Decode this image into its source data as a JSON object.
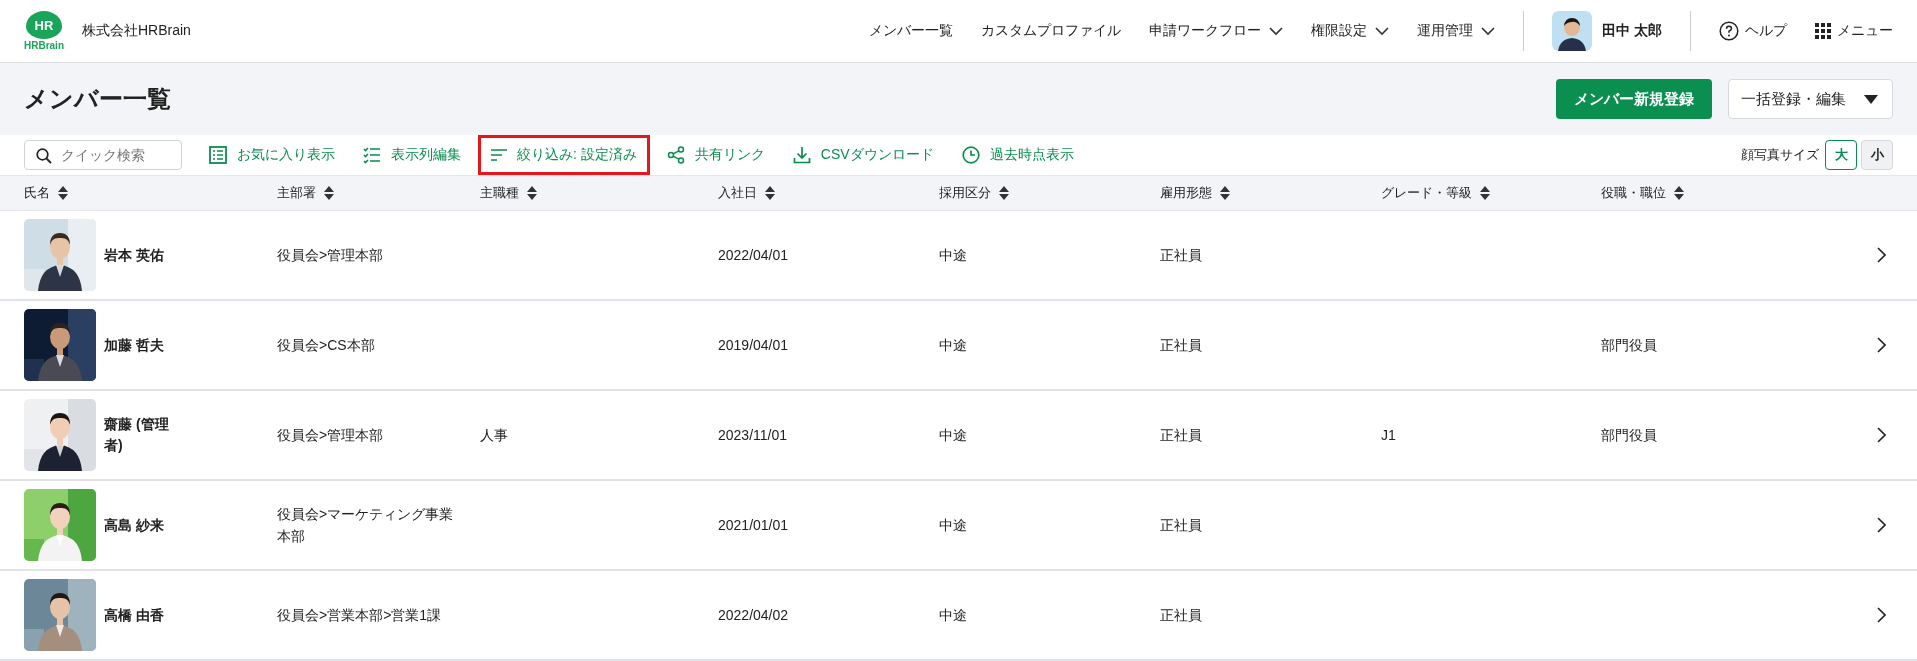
{
  "header": {
    "logo": {
      "mark": "HR",
      "wordmark": "HRBrain"
    },
    "company": "株式会社HRBrain",
    "nav": [
      {
        "label": "メンバー一覧",
        "dropdown": false
      },
      {
        "label": "カスタムプロファイル",
        "dropdown": false
      },
      {
        "label": "申請ワークフロー",
        "dropdown": true
      },
      {
        "label": "権限設定",
        "dropdown": true
      },
      {
        "label": "運用管理",
        "dropdown": true
      }
    ],
    "user": "田中 太郎",
    "help": "ヘルプ",
    "menu": "メニュー"
  },
  "page": {
    "title": "メンバー一覧",
    "primary_button": "メンバー新規登録",
    "bulk_button": "一括登録・編集"
  },
  "toolbar": {
    "search": {
      "placeholder": "クイック検索"
    },
    "actions": [
      {
        "label": "お気に入り表示",
        "highlighted": false
      },
      {
        "label": "表示列編集",
        "highlighted": false
      },
      {
        "label": "絞り込み: 設定済み",
        "highlighted": true
      },
      {
        "label": "共有リンク",
        "highlighted": false
      },
      {
        "label": "CSVダウンロード",
        "highlighted": false
      },
      {
        "label": "過去時点表示",
        "highlighted": false
      }
    ],
    "photo_size": {
      "label": "顔写真サイズ",
      "options": [
        {
          "label": "大",
          "selected": true
        },
        {
          "label": "小",
          "selected": false
        }
      ]
    }
  },
  "table": {
    "columns": [
      "氏名",
      "主部署",
      "主職種",
      "入社日",
      "採用区分",
      "雇用形態",
      "グレード・等級",
      "役職・職位"
    ],
    "rows": [
      {
        "cells": [
          "岩本 英佑",
          "役員会>管理本部",
          "",
          "2022/04/01",
          "中途",
          "正社員",
          "",
          ""
        ]
      },
      {
        "cells": [
          "加藤 哲夫",
          "役員会>CS本部",
          "",
          "2019/04/01",
          "中途",
          "正社員",
          "",
          "部門役員"
        ]
      },
      {
        "cells": [
          "齋藤 (管理者)",
          "役員会>管理本部",
          "人事",
          "2023/11/01",
          "中途",
          "正社員",
          "J1",
          "部門役員"
        ]
      },
      {
        "cells": [
          "高島 紗来",
          "役員会>マーケティング事業本部",
          "",
          "2021/01/01",
          "中途",
          "正社員",
          "",
          ""
        ]
      },
      {
        "cells": [
          "高橋 由香",
          "役員会>営業本部>営業1課",
          "",
          "2022/04/02",
          "中途",
          "正社員",
          "",
          ""
        ]
      }
    ]
  }
}
